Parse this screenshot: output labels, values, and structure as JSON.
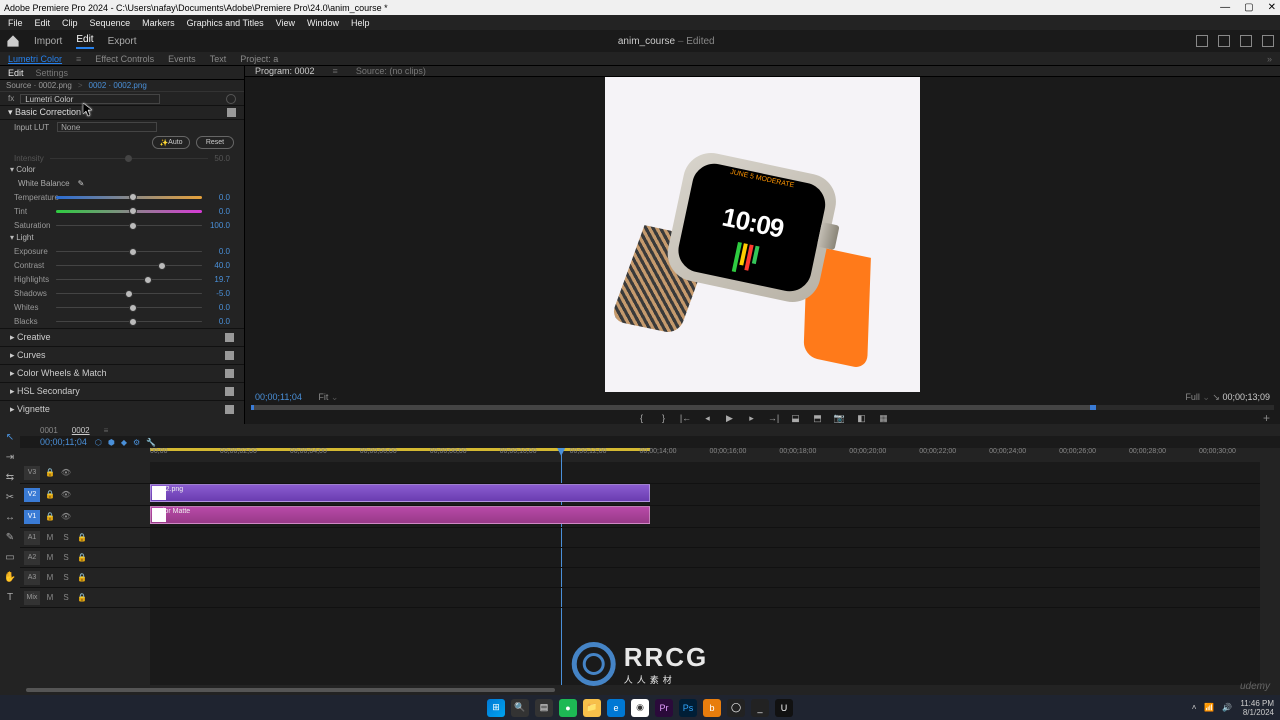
{
  "app": {
    "title": "Adobe Premiere Pro 2024 - C:\\Users\\nafay\\Documents\\Adobe\\Premiere Pro\\24.0\\anim_course *"
  },
  "menu": [
    "File",
    "Edit",
    "Clip",
    "Sequence",
    "Markers",
    "Graphics and Titles",
    "View",
    "Window",
    "Help"
  ],
  "workspace": {
    "tabs": [
      "Import",
      "Edit",
      "Export"
    ],
    "active": "Edit",
    "project": "anim_course",
    "status": "Edited"
  },
  "panel_tabs_left": [
    "Lumetri Color",
    "Effect Controls",
    "Events",
    "Text",
    "Project: a"
  ],
  "panel_tabs_left_active": 0,
  "lumetri": {
    "tabs": [
      "Edit",
      "Settings"
    ],
    "source_label": "Source · 0002.png",
    "clip_link": "0002 · 0002.png",
    "fx_name": "Lumetri Color",
    "basic": {
      "title": "Basic Correction",
      "input_lut_label": "Input LUT",
      "input_lut_value": "None",
      "auto_btn": "Auto",
      "reset_btn": "Reset",
      "intensity_label": "Intensity",
      "intensity_value": "50.0",
      "color_label": "Color",
      "wb_label": "White Balance",
      "sliders_color": [
        {
          "label": "Temperature",
          "value": "0.0",
          "pos": 50,
          "grad": "temp-grad"
        },
        {
          "label": "Tint",
          "value": "0.0",
          "pos": 50,
          "grad": "tint-grad"
        },
        {
          "label": "Saturation",
          "value": "100.0",
          "pos": 50,
          "grad": "plain"
        }
      ],
      "light_label": "Light",
      "sliders_light": [
        {
          "label": "Exposure",
          "value": "0.0",
          "pos": 50
        },
        {
          "label": "Contrast",
          "value": "40.0",
          "pos": 70
        },
        {
          "label": "Highlights",
          "value": "19.7",
          "pos": 60
        },
        {
          "label": "Shadows",
          "value": "-5.0",
          "pos": 47
        },
        {
          "label": "Whites",
          "value": "0.0",
          "pos": 50
        },
        {
          "label": "Blacks",
          "value": "0.0",
          "pos": 50
        }
      ]
    },
    "collapsed": [
      "Creative",
      "Curves",
      "Color Wheels & Match",
      "HSL Secondary",
      "Vignette"
    ]
  },
  "program": {
    "tabs": [
      "Program: 0002",
      "Source: (no clips)"
    ],
    "active_tab": 0,
    "timecode": "00;00;11;04",
    "fit_label": "Fit",
    "full_label": "Full",
    "duration": "00;00;13;09",
    "watch_time": "10:09",
    "watch_sub": "JUNE 5 MODERATE",
    "controls": [
      "mark-in",
      "mark-out",
      "go-in",
      "step-back",
      "play",
      "step-fwd",
      "go-out",
      "lift",
      "extract",
      "export-frame",
      "comp",
      "safe"
    ]
  },
  "timeline": {
    "seq_tabs": [
      "0001",
      "0002"
    ],
    "active_seq": 1,
    "timecode": "00;00;11;04",
    "ruler": [
      "00;00",
      "00;00;02;00",
      "00;00;04;00",
      "00;00;06;00",
      "00;00;08;00",
      "00;00;10;00",
      "00;00;12;00",
      "00;00;14;00",
      "00;00;16;00",
      "00;00;18;00",
      "00;00;20;00",
      "00;00;22;00",
      "00;00;24;00",
      "00;00;26;00",
      "00;00;28;00",
      "00;00;30;00"
    ],
    "playhead_pct": 37,
    "tracks_video": [
      {
        "name": "V3"
      },
      {
        "name": "V2",
        "clip": {
          "label": "0002.png",
          "start": 0,
          "end": 45,
          "type": "video"
        }
      },
      {
        "name": "V1",
        "clip": {
          "label": "Color Matte",
          "start": 0,
          "end": 45,
          "type": "matte"
        }
      }
    ],
    "tracks_audio": [
      {
        "name": "A1"
      },
      {
        "name": "A2"
      },
      {
        "name": "A3"
      },
      {
        "name": "Mix"
      }
    ]
  },
  "tools": [
    "select",
    "track-fwd",
    "ripple",
    "razor",
    "slip",
    "pen",
    "rect",
    "hand",
    "type"
  ],
  "taskbar": {
    "apps": [
      "Start",
      "Search",
      "TaskView",
      "Widgets",
      "Spotify",
      "Explorer",
      "Edge",
      "Chrome",
      "Premiere",
      "Photoshop",
      "Blender",
      "OBS",
      "Terminal",
      "Unreal"
    ],
    "time": "11:46 PM",
    "date": "8/1/2024"
  },
  "watermark": {
    "big": "RRCG",
    "small": "人人素材"
  }
}
